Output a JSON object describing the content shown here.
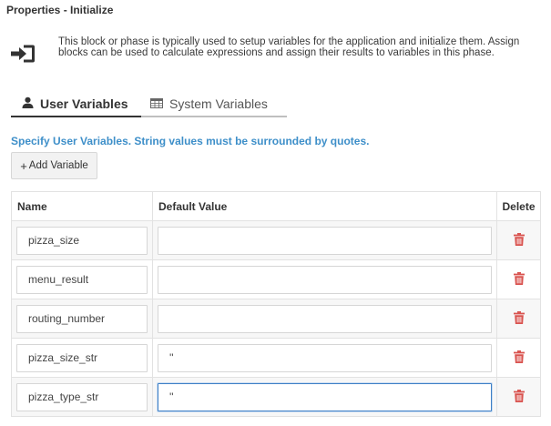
{
  "panel": {
    "title": "Properties - Initialize"
  },
  "intro": {
    "icon": "sign-in-icon",
    "text": "This block or phase is typically used to setup variables for the application and initialize them. Assign blocks can be used to calculate expressions and assign their results to variables in this phase."
  },
  "tabs": [
    {
      "label": "User Variables",
      "icon": "user-icon",
      "active": true
    },
    {
      "label": "System Variables",
      "icon": "table-icon",
      "active": false
    }
  ],
  "hint": "Specify User Variables. String values must be surrounded by quotes.",
  "add_button": {
    "icon": "+",
    "label": "Add Variable"
  },
  "table": {
    "headers": {
      "name": "Name",
      "default": "Default Value",
      "delete": "Delete"
    },
    "rows": [
      {
        "name": "pizza_size",
        "default": ""
      },
      {
        "name": "menu_result",
        "default": ""
      },
      {
        "name": "routing_number",
        "default": ""
      },
      {
        "name": "pizza_size_str",
        "default": "''"
      },
      {
        "name": "pizza_type_str",
        "default": "''"
      }
    ]
  },
  "colors": {
    "hint": "#3e8fc9",
    "delete_icon": "#d9534f",
    "focus_border": "#3d7fc6"
  }
}
